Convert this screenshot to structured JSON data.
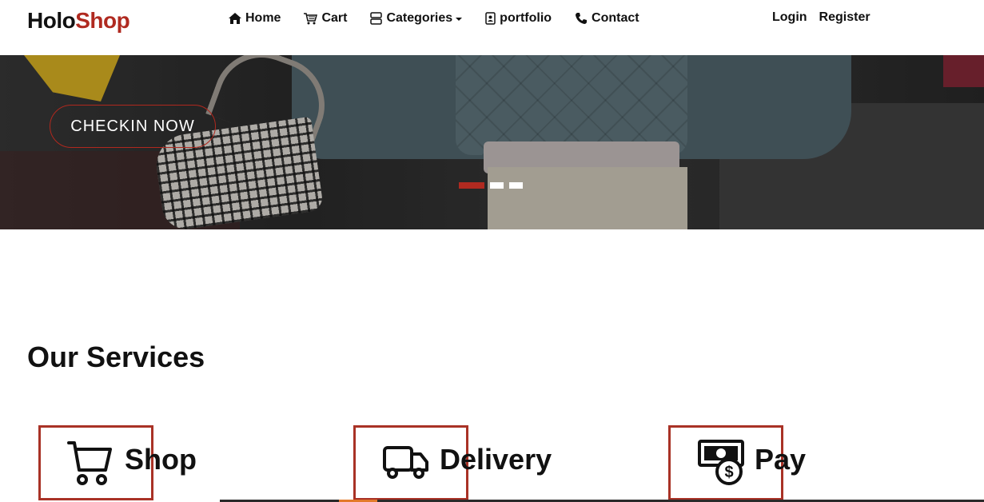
{
  "brand": {
    "part1": "Holo",
    "part2": "Shop"
  },
  "nav": {
    "items": [
      {
        "label": "Home",
        "icon": "home-icon"
      },
      {
        "label": "Cart",
        "icon": "cart-icon"
      },
      {
        "label": "Categories",
        "icon": "categories-icon"
      },
      {
        "label": "portfolio",
        "icon": "portfolio-icon"
      },
      {
        "label": "Contact",
        "icon": "phone-icon"
      }
    ],
    "login": "Login",
    "register": "Register"
  },
  "hero": {
    "cta_label": "CHECKIN NOW",
    "slides": 3,
    "active_slide": 0
  },
  "services": {
    "title": "Our Services",
    "items": [
      {
        "label": "Shop",
        "icon": "shopping-cart-icon"
      },
      {
        "label": "Delivery",
        "icon": "truck-icon"
      },
      {
        "label": "Pay",
        "icon": "money-icon"
      }
    ]
  },
  "colors": {
    "accent": "#b02a20",
    "text": "#111111",
    "background": "#ffffff"
  }
}
